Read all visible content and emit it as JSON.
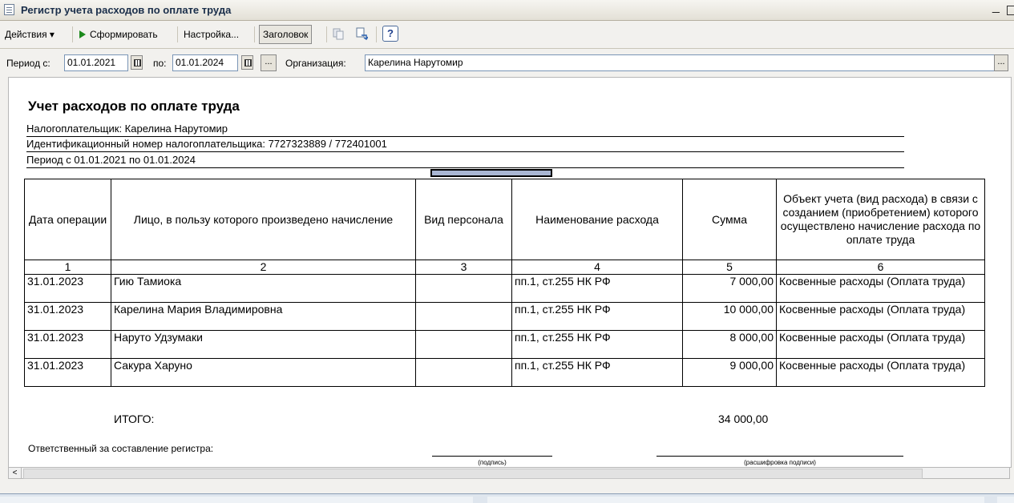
{
  "window": {
    "title": "Регистр учета расходов по оплате труда",
    "min_glyph": "_"
  },
  "toolbar": {
    "actions_label": "Действия",
    "actions_arrow": "▾",
    "generate_label": "Сформировать",
    "settings_label": "Настройка...",
    "header_label": "Заголовок",
    "help_glyph": "?"
  },
  "period": {
    "from_label": "Период с:",
    "from_value": "01.01.2021",
    "to_label": "по:",
    "to_value": "01.01.2024",
    "dots": "...",
    "org_label": "Организация:",
    "org_value": "Карелина Нарутомир",
    "org_dots": "..."
  },
  "report": {
    "title": "Учет расходов по оплате труда",
    "taxpayer": "Налогоплательщик: Карелина Нарутомир",
    "inn": "Идентификационный номер налогоплательщика: 7727323889 / 772401001",
    "period": "Период с 01.01.2021 по 01.01.2024",
    "columns": [
      "Дата операции",
      "Лицо, в пользу которого произведено начисление",
      "Вид персонала",
      "Наименование расхода",
      "Сумма",
      "Объект учета (вид расхода) в связи с созданием (приобретением) которого осуществлено начисление расхода по оплате труда"
    ],
    "column_numbers": [
      "1",
      "2",
      "3",
      "4",
      "5",
      "6"
    ],
    "rows": [
      {
        "date": "31.01.2023",
        "person": "Гию Тамиока",
        "staff": "",
        "expense": "пп.1, ст.255 НК РФ",
        "sum": "7 000,00",
        "object": "Косвенные расходы (Оплата труда)"
      },
      {
        "date": "31.01.2023",
        "person": "Карелина Мария Владимировна",
        "staff": "",
        "expense": "пп.1, ст.255 НК РФ",
        "sum": "10 000,00",
        "object": "Косвенные расходы (Оплата труда)"
      },
      {
        "date": "31.01.2023",
        "person": "Наруто Удзумаки",
        "staff": "",
        "expense": "пп.1, ст.255 НК РФ",
        "sum": "8 000,00",
        "object": "Косвенные расходы (Оплата труда)"
      },
      {
        "date": "31.01.2023",
        "person": "Сакура Харуно",
        "staff": "",
        "expense": "пп.1, ст.255 НК РФ",
        "sum": "9 000,00",
        "object": "Косвенные расходы (Оплата труда)"
      }
    ],
    "total_label": "ИТОГО:",
    "total_value": "34 000,00",
    "responsible_label": "Ответственный за составление регистра:",
    "signature_caption": "(подпись)",
    "signature_decode_caption": "(расшифровка подписи)"
  },
  "scroll": {
    "left_arrow": "<"
  }
}
